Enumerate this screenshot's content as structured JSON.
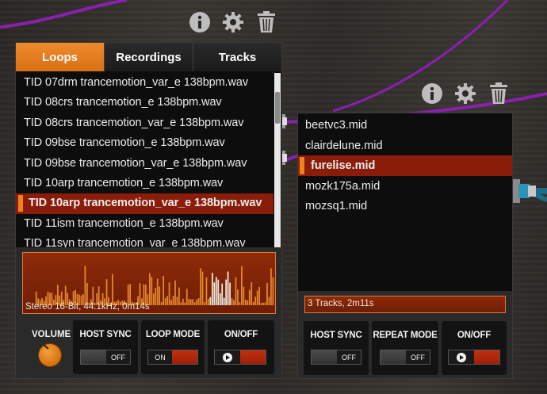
{
  "top_icons": [
    "info-icon",
    "gear-icon",
    "trash-icon"
  ],
  "colors": {
    "accent": "#e87a1e",
    "selected_row": "#8a1c0a",
    "waveform_bg": "#7a2206",
    "cable": "#8a1fb0"
  },
  "left_panel": {
    "tabs": [
      {
        "label": "Loops",
        "active": true
      },
      {
        "label": "Recordings",
        "active": false
      },
      {
        "label": "Tracks",
        "active": false
      }
    ],
    "files": [
      "TID 07drm trancemotion_var_e 138bpm.wav",
      "TID 08crs trancemotion_e 138bpm.wav",
      "TID 08crs trancemotion_var_e 138bpm.wav",
      "TID 09bse trancemotion_e 138bpm.wav",
      "TID 09bse trancemotion_var_e 138bpm.wav",
      "TID 10arp trancemotion_e 138bpm.wav",
      "TID 10arp trancemotion_var_e 138bpm.wav",
      "TID 11ism trancemotion_e 138bpm.wav",
      "TID 11syn trancemotion_var_e 138bpm.wav"
    ],
    "selected_index": 6,
    "wave_info": "Stereo 16-Bit, 44.1kHz, 0m14s",
    "volume_label": "VOLUME",
    "host_sync": {
      "label": "HOST SYNC",
      "state": "OFF"
    },
    "loop_mode": {
      "label": "LOOP MODE",
      "state": "ON"
    },
    "on_off": {
      "label": "ON/OFF"
    }
  },
  "right_panel": {
    "tracks": [
      "beetvc3.mid",
      "clairdelune.mid",
      "furelise.mid",
      "mozk175a.mid",
      "mozsq1.mid"
    ],
    "selected_index": 2,
    "info": "3 Tracks, 2m11s",
    "host_sync": {
      "label": "HOST SYNC",
      "state": "OFF"
    },
    "repeat_mode": {
      "label": "REPEAT MODE",
      "state": "OFF"
    },
    "on_off": {
      "label": "ON/OFF"
    }
  }
}
